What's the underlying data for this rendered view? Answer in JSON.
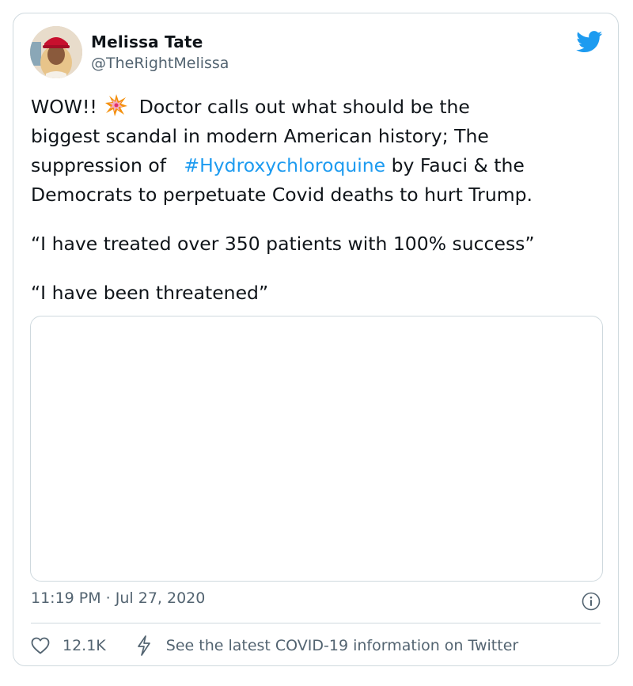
{
  "tweet": {
    "author_name": "Melissa Tate",
    "handle": "@TheRightMelissa",
    "text_line1_before": "WOW!!",
    "text_line1_after": "Doctor calls out what should be the",
    "text_line2": "biggest scandal in modern American history; The",
    "text_line3_before": "suppression of ",
    "hashtag": "#Hydroxychloroquine",
    "text_line3_after": " by Fauci & the",
    "text_line4": "Democrats to perpetuate Covid deaths to hurt Trump.",
    "quote1": "“I have treated over 350 patients with 100% success”",
    "quote2": "“I have been threatened”",
    "timestamp": "11:19 PM · Jul 27, 2020",
    "like_count": "12.1K",
    "covid_info": "See the latest COVID-19 information on Twitter"
  },
  "icons": {
    "brand": "twitter-bird-icon",
    "emoji": "collision-emoji",
    "info": "info-icon",
    "like": "heart-icon",
    "covid": "lightning-icon"
  },
  "colors": {
    "link": "#1d9bf0",
    "twitter_blue": "#1d9bf0",
    "muted": "#536471",
    "border": "#cfd9de"
  }
}
